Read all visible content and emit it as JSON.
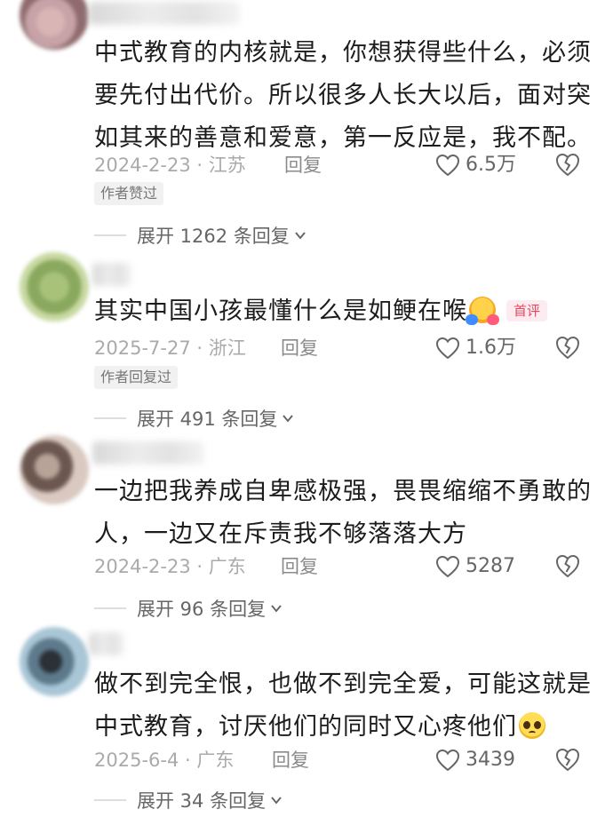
{
  "comments": [
    {
      "text": "中式教育的内核就是，你想获得些什么，必须要先付出代价。所以很多人长大以后，面对突如其来的善意和爱意，第一反应是，我不配。",
      "lines": [
        "中式教育的内核就是，你想获得些什么，必须",
        "要先付出代价。所以很多人长大以后，面对突",
        "如其来的善意和爱意，第一反应是，我不配。"
      ],
      "date": "2024-2-23 · 江苏",
      "reply_label": "回复",
      "likes": "6.5万",
      "author_tag": "作者赞过",
      "expand_label": "展开 1262 条回复"
    },
    {
      "text": "其实中国小孩最懂什么是如鲠在喉",
      "lines": [
        "其实中国小孩最懂什么是如鲠在喉"
      ],
      "emoji": "hug-emoji",
      "badge": "首评",
      "date": "2025-7-27 · 浙江",
      "reply_label": "回复",
      "likes": "1.6万",
      "author_tag": "作者回复过",
      "expand_label": "展开 491 条回复"
    },
    {
      "text": "一边把我养成自卑感极强，畏畏缩缩不勇敢的人，一边又在斥责我不够落落大方",
      "lines": [
        "一边把我养成自卑感极强，畏畏缩缩不勇敢的",
        "人，一边又在斥责我不够落落大方"
      ],
      "date": "2024-2-23 · 广东",
      "reply_label": "回复",
      "likes": "5287",
      "expand_label": "展开 96 条回复"
    },
    {
      "text": "做不到完全恨，也做不到完全爱，可能这就是中式教育，讨厌他们的同时又心疼他们",
      "lines": [
        "做不到完全恨，也做不到完全爱，可能这就是",
        "中式教育，讨厌他们的同时又心疼他们"
      ],
      "emoji": "pleading-emoji",
      "date": "2025-6-4 · 广东",
      "reply_label": "回复",
      "likes": "3439",
      "expand_label": "展开 34 条回复"
    }
  ],
  "colors": {
    "text": "#1c1c1c",
    "meta": "#aaaaaa",
    "badge": "#e8455f",
    "badge_bg": "#fdecef",
    "tag_bg": "#f1f1f1"
  }
}
